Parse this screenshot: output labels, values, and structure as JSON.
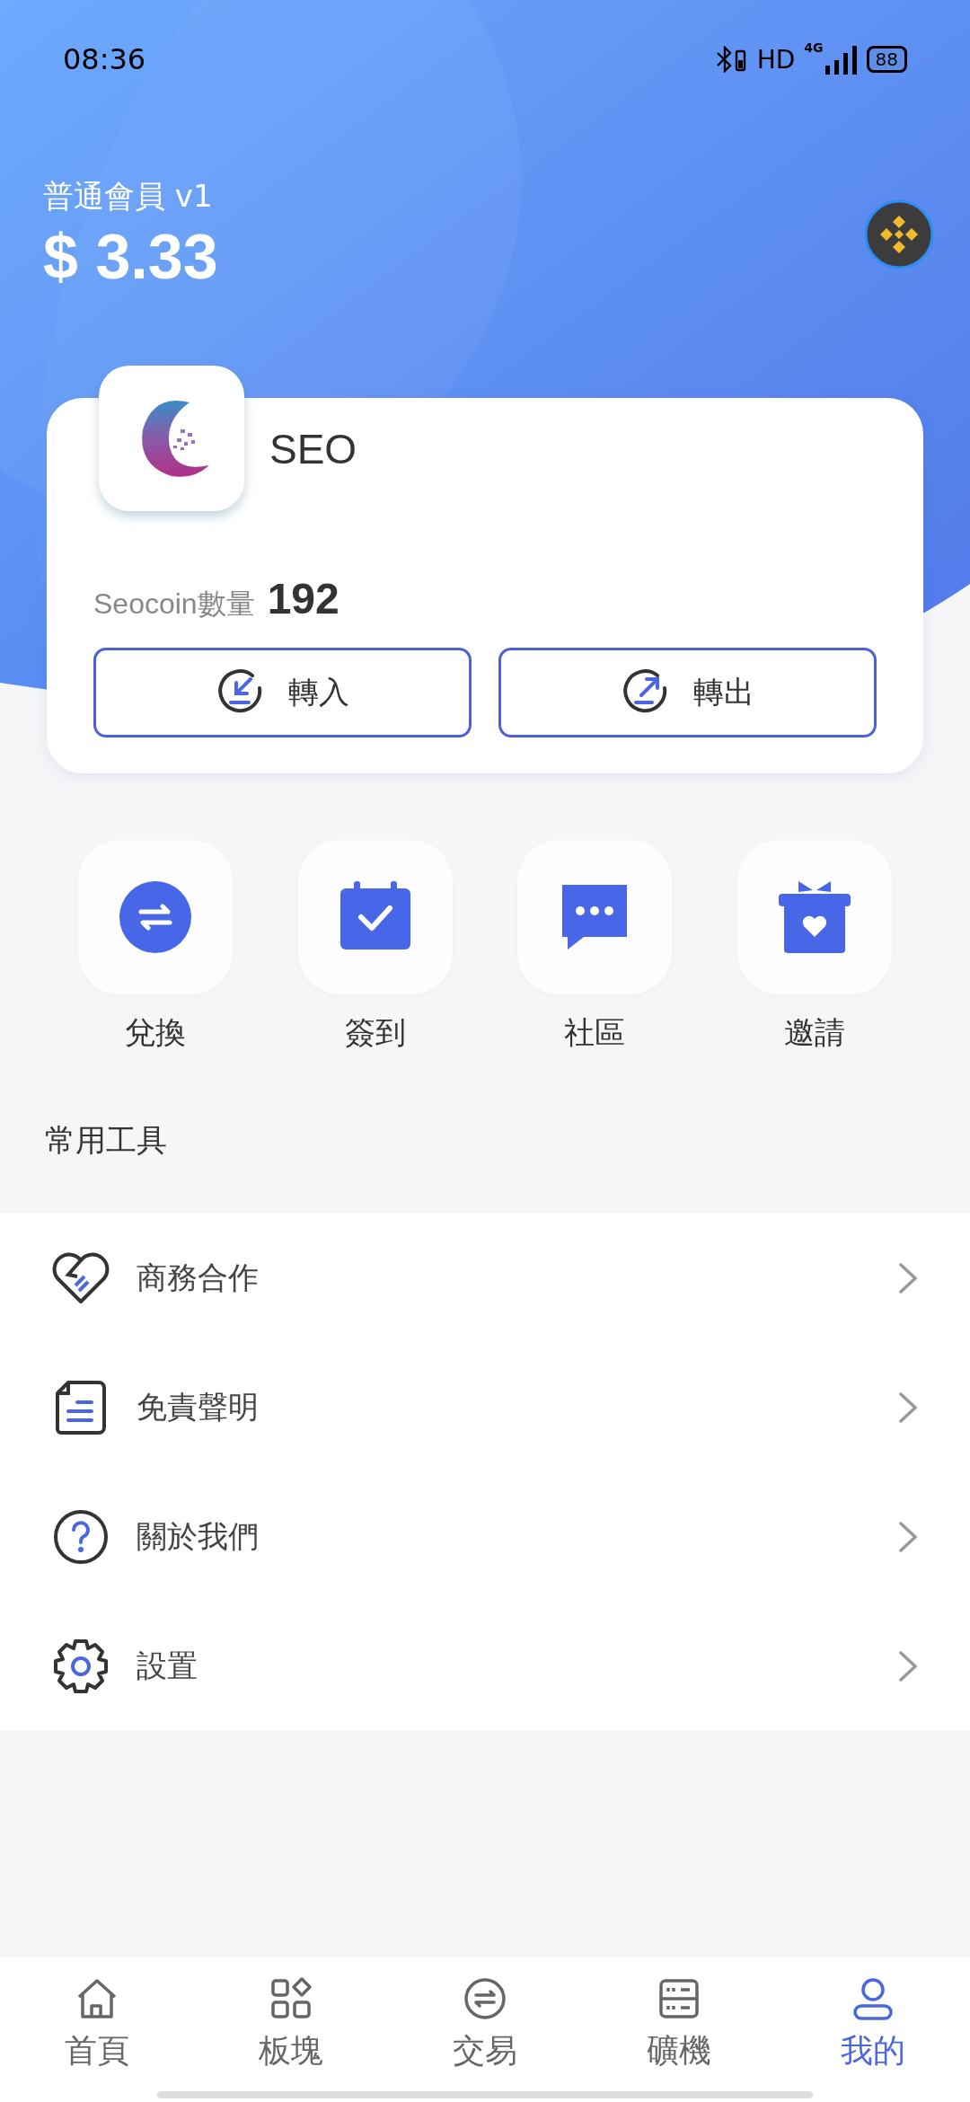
{
  "status_bar": {
    "time": "08:36",
    "hd": "HD",
    "network": "4G",
    "battery": "88"
  },
  "header": {
    "member": "普通會員 v1",
    "balance": "$ 3.33"
  },
  "coin_card": {
    "name": "SEO",
    "amount_label": "Seocoin數量",
    "amount": "192",
    "buttons": [
      {
        "kind": "in",
        "label": "轉入"
      },
      {
        "kind": "out",
        "label": "轉出"
      }
    ]
  },
  "shortcuts": [
    {
      "kind": "exchange",
      "label": "兌換"
    },
    {
      "kind": "checkin",
      "label": "簽到"
    },
    {
      "kind": "community",
      "label": "社區"
    },
    {
      "kind": "invite",
      "label": "邀請"
    }
  ],
  "tools": {
    "title": "常用工具",
    "items": [
      {
        "kind": "partner",
        "label": "商務合作"
      },
      {
        "kind": "disclaimer",
        "label": "免責聲明"
      },
      {
        "kind": "about",
        "label": "關於我們"
      },
      {
        "kind": "settings",
        "label": "設置"
      }
    ]
  },
  "tab_bar": [
    {
      "kind": "home",
      "label": "首頁",
      "selected": false
    },
    {
      "kind": "blocks",
      "label": "板塊",
      "selected": false
    },
    {
      "kind": "trade",
      "label": "交易",
      "selected": false
    },
    {
      "kind": "mining",
      "label": "礦機",
      "selected": false
    },
    {
      "kind": "me",
      "label": "我的",
      "selected": true
    }
  ]
}
